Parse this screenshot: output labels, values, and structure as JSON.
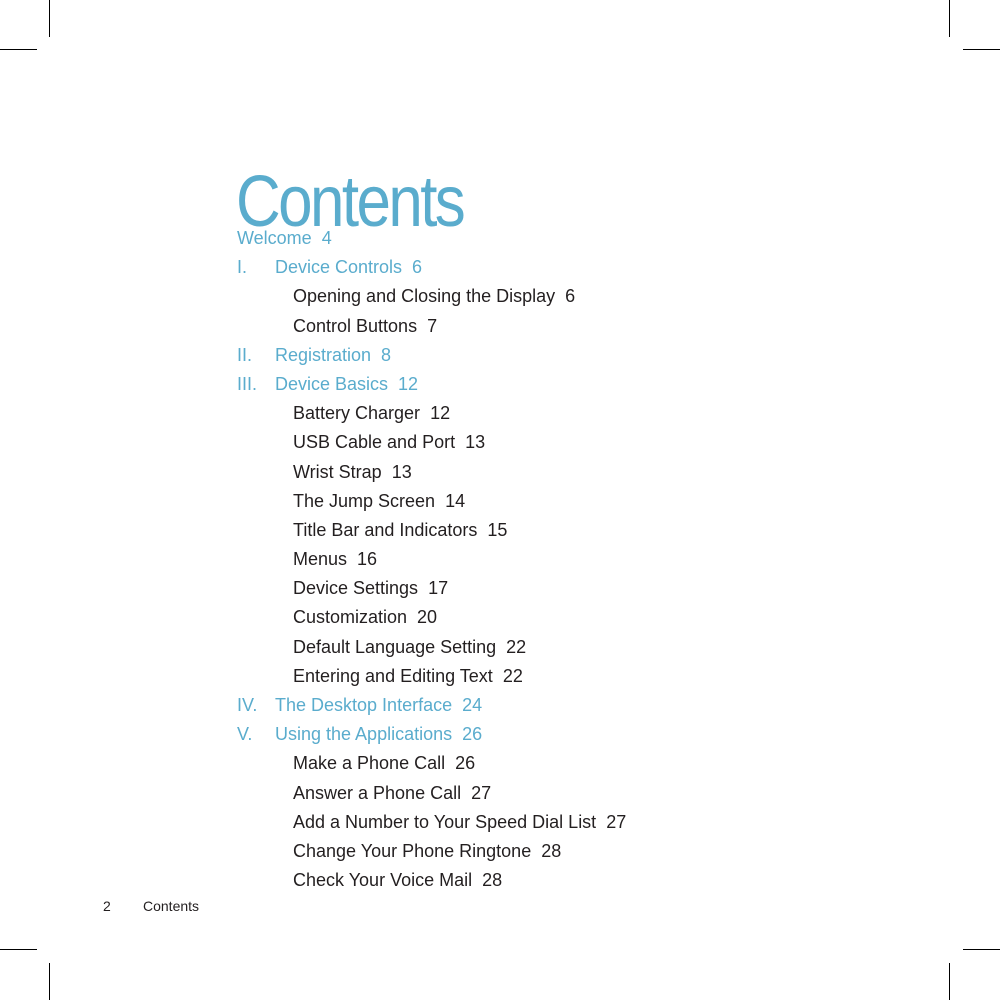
{
  "page": {
    "title": "Contents",
    "accent_color": "#5aaccd",
    "text_color": "#231f20"
  },
  "toc": [
    {
      "level": "chapter",
      "number": "",
      "label": "Welcome",
      "page": "4"
    },
    {
      "level": "chapter",
      "number": "I.",
      "label": "Device Controls",
      "page": "6"
    },
    {
      "level": "sub",
      "number": "",
      "label": "Opening and Closing the Display",
      "page": "6"
    },
    {
      "level": "sub",
      "number": "",
      "label": "Control Buttons",
      "page": "7"
    },
    {
      "level": "chapter",
      "number": "II.",
      "label": "Registration",
      "page": "8"
    },
    {
      "level": "chapter",
      "number": "III.",
      "label": "Device Basics",
      "page": "12"
    },
    {
      "level": "sub",
      "number": "",
      "label": "Battery Charger",
      "page": "12"
    },
    {
      "level": "sub",
      "number": "",
      "label": "USB Cable and Port",
      "page": "13"
    },
    {
      "level": "sub",
      "number": "",
      "label": "Wrist Strap",
      "page": "13"
    },
    {
      "level": "sub",
      "number": "",
      "label": "The Jump Screen",
      "page": "14"
    },
    {
      "level": "sub",
      "number": "",
      "label": "Title Bar and Indicators",
      "page": "15"
    },
    {
      "level": "sub",
      "number": "",
      "label": "Menus",
      "page": "16"
    },
    {
      "level": "sub",
      "number": "",
      "label": "Device Settings",
      "page": "17"
    },
    {
      "level": "sub",
      "number": "",
      "label": "Customization",
      "page": "20"
    },
    {
      "level": "sub",
      "number": "",
      "label": "Default Language Setting",
      "page": "22"
    },
    {
      "level": "sub",
      "number": "",
      "label": "Entering and Editing Text",
      "page": "22"
    },
    {
      "level": "chapter",
      "number": "IV.",
      "label": "The Desktop Interface",
      "page": "24"
    },
    {
      "level": "chapter",
      "number": "V.",
      "label": "Using the Applications",
      "page": "26"
    },
    {
      "level": "sub",
      "number": "",
      "label": "Make a Phone Call",
      "page": "26"
    },
    {
      "level": "sub",
      "number": "",
      "label": "Answer a Phone Call",
      "page": "27"
    },
    {
      "level": "sub",
      "number": "",
      "label": "Add a Number to Your Speed Dial List",
      "page": "27"
    },
    {
      "level": "sub",
      "number": "",
      "label": "Change Your Phone Ringtone",
      "page": "28"
    },
    {
      "level": "sub",
      "number": "",
      "label": "Check Your Voice Mail",
      "page": "28"
    }
  ],
  "footer": {
    "page_number": "2",
    "section_label": "Contents"
  }
}
